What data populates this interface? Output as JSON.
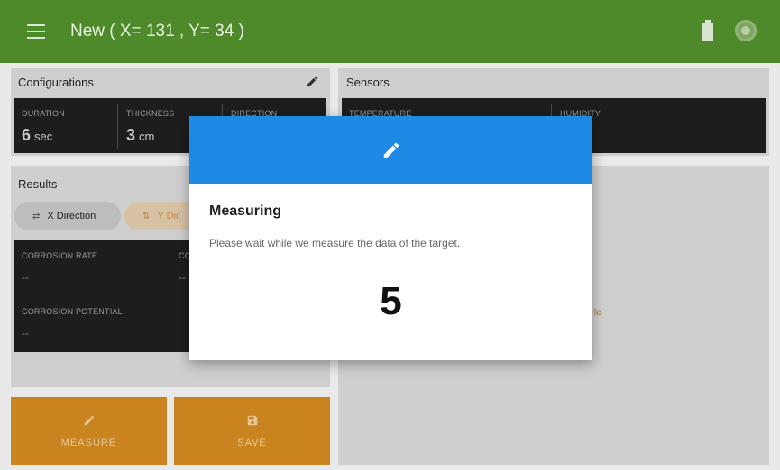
{
  "appbar": {
    "title": "New ( X= 131 , Y= 34 )",
    "menu_icon": "menu-icon",
    "battery_icon": "battery-icon",
    "status_icon": "status-dot"
  },
  "configurations": {
    "title": "Configurations",
    "edit_icon": "pencil-icon",
    "cells": [
      {
        "label": "DURATION",
        "value": "6",
        "unit": "sec"
      },
      {
        "label": "THICKNESS",
        "value": "3",
        "unit": "cm"
      },
      {
        "label": "DIRECTION",
        "value": ""
      }
    ]
  },
  "sensors": {
    "title": "Sensors",
    "cells": [
      {
        "label": "TEMPERATURE",
        "value": ""
      },
      {
        "label": "HUMIDITY",
        "value": ""
      }
    ]
  },
  "results": {
    "title": "Results",
    "chips": [
      {
        "label": "X Direction"
      },
      {
        "label": "Y Dir"
      }
    ],
    "cells": [
      {
        "label": "CORROSION RATE",
        "value": "--"
      },
      {
        "label": "CO",
        "value": "--"
      },
      {
        "label": "CORROSION POTENTIAL",
        "value": "--"
      }
    ],
    "side_note": "le"
  },
  "actions": {
    "measure_label": "MEASURE",
    "save_label": "SAVE"
  },
  "dialog": {
    "title": "Measuring",
    "message": "Please wait while we measure the data of the target.",
    "countdown": "5",
    "header_icon": "pencil-icon"
  },
  "colors": {
    "appbar": "#4e8a2a",
    "dialog_header": "#1f8ae6",
    "action_button": "#c98420"
  }
}
